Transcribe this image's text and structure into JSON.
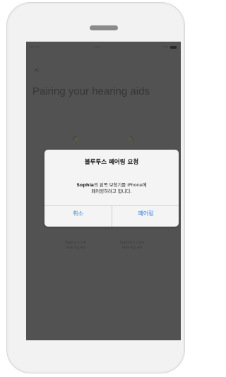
{
  "status_bar": {
    "carrier": "━━ ━━",
    "time": "━━━",
    "right": "━━━"
  },
  "background": {
    "back_glyph": "<",
    "title": "Pairing your hearing aids",
    "left_caption": "Sophia's left\nhearing aid",
    "right_caption": "Sophia's right\nhearing aid"
  },
  "dialog": {
    "title": "블루투스 페어링 요청",
    "message_name": "Sophia",
    "message_rest_line1": "의 왼쪽 보청기를 iPhone에",
    "message_line2": "페어링하려고 합니다.",
    "cancel_label": "취소",
    "pair_label": "페어링"
  },
  "colors": {
    "accent": "#2f7ce0",
    "screen_bg": "#595959",
    "dialog_bg": "#f4f4f4"
  }
}
